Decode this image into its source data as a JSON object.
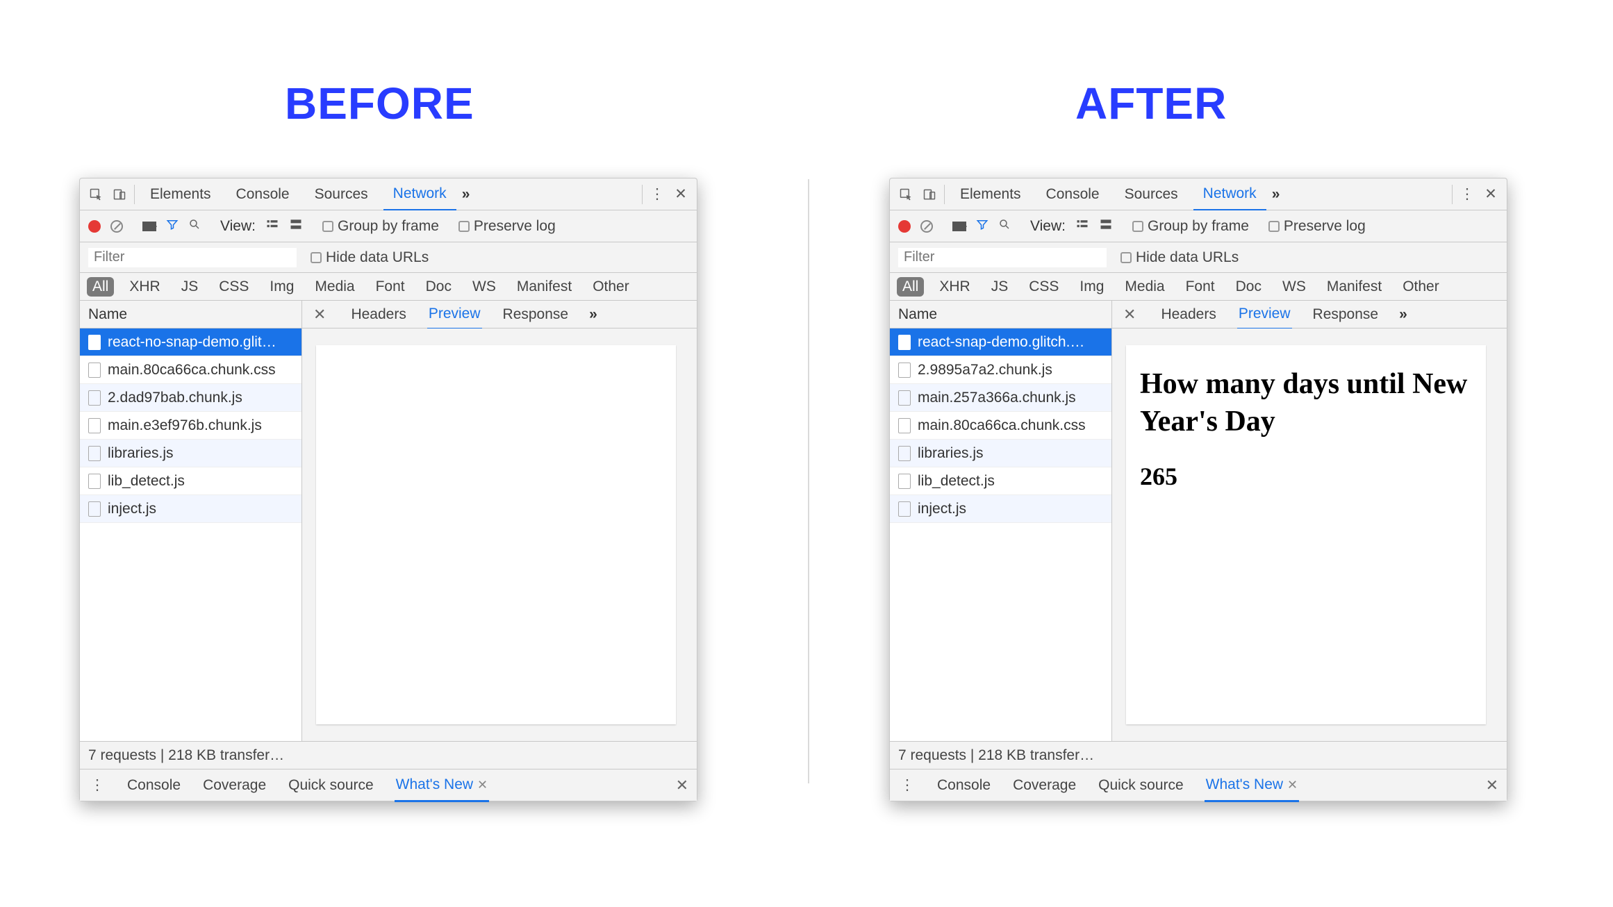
{
  "headings": {
    "before": "BEFORE",
    "after": "AFTER"
  },
  "tabs": {
    "elements": "Elements",
    "console": "Console",
    "sources": "Sources",
    "network": "Network"
  },
  "toolbar": {
    "view": "View:",
    "group_by_frame": "Group by frame",
    "preserve_log": "Preserve log"
  },
  "filter": {
    "placeholder": "Filter",
    "hide_data_urls": "Hide data URLs"
  },
  "types": [
    "All",
    "XHR",
    "JS",
    "CSS",
    "Img",
    "Media",
    "Font",
    "Doc",
    "WS",
    "Manifest",
    "Other"
  ],
  "listheader": "Name",
  "subtabs": {
    "headers": "Headers",
    "preview": "Preview",
    "response": "Response"
  },
  "status": "7 requests | 218 KB transfer…",
  "drawer": {
    "console": "Console",
    "coverage": "Coverage",
    "quick": "Quick source",
    "whatsnew": "What's New"
  },
  "before": {
    "requests": [
      "react-no-snap-demo.glit…",
      "main.80ca66ca.chunk.css",
      "2.dad97bab.chunk.js",
      "main.e3ef976b.chunk.js",
      "libraries.js",
      "lib_detect.js",
      "inject.js"
    ],
    "preview_html": ""
  },
  "after": {
    "requests": [
      "react-snap-demo.glitch.…",
      "2.9895a7a2.chunk.js",
      "main.257a366a.chunk.js",
      "main.80ca66ca.chunk.css",
      "libraries.js",
      "lib_detect.js",
      "inject.js"
    ],
    "preview_title": "How many days until New Year's Day",
    "preview_value": "265"
  }
}
